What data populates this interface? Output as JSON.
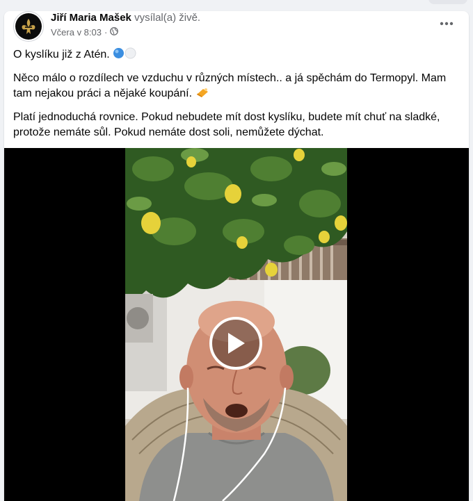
{
  "post": {
    "author": "Jiří Maria Mašek",
    "action": "vysílal(a) živě.",
    "time": "Včera v 8:03",
    "separator": "·",
    "privacy_icon": "globe-icon",
    "more_icon": "more-dots-icon",
    "paragraphs": [
      "O kyslíku již z Atén.",
      "Něco málo o rozdílech ve vzduchu v různých místech.. a já spěchám do Termopyl. Mam tam nejakou práci a nějaké koupání.",
      "Platí jednoduchá rovnice. Pokud nebudete mít dost kyslíku, budete mít chuť na sladké, protože nemáte sůl. Pokud nemáte dost soli, nemůžete dýchat."
    ]
  },
  "video": {
    "play_icon": "play-icon"
  },
  "colors": {
    "page_bg": "#f0f2f5",
    "text": "#050505",
    "secondary_text": "#65676b",
    "video_bg": "#000000"
  }
}
